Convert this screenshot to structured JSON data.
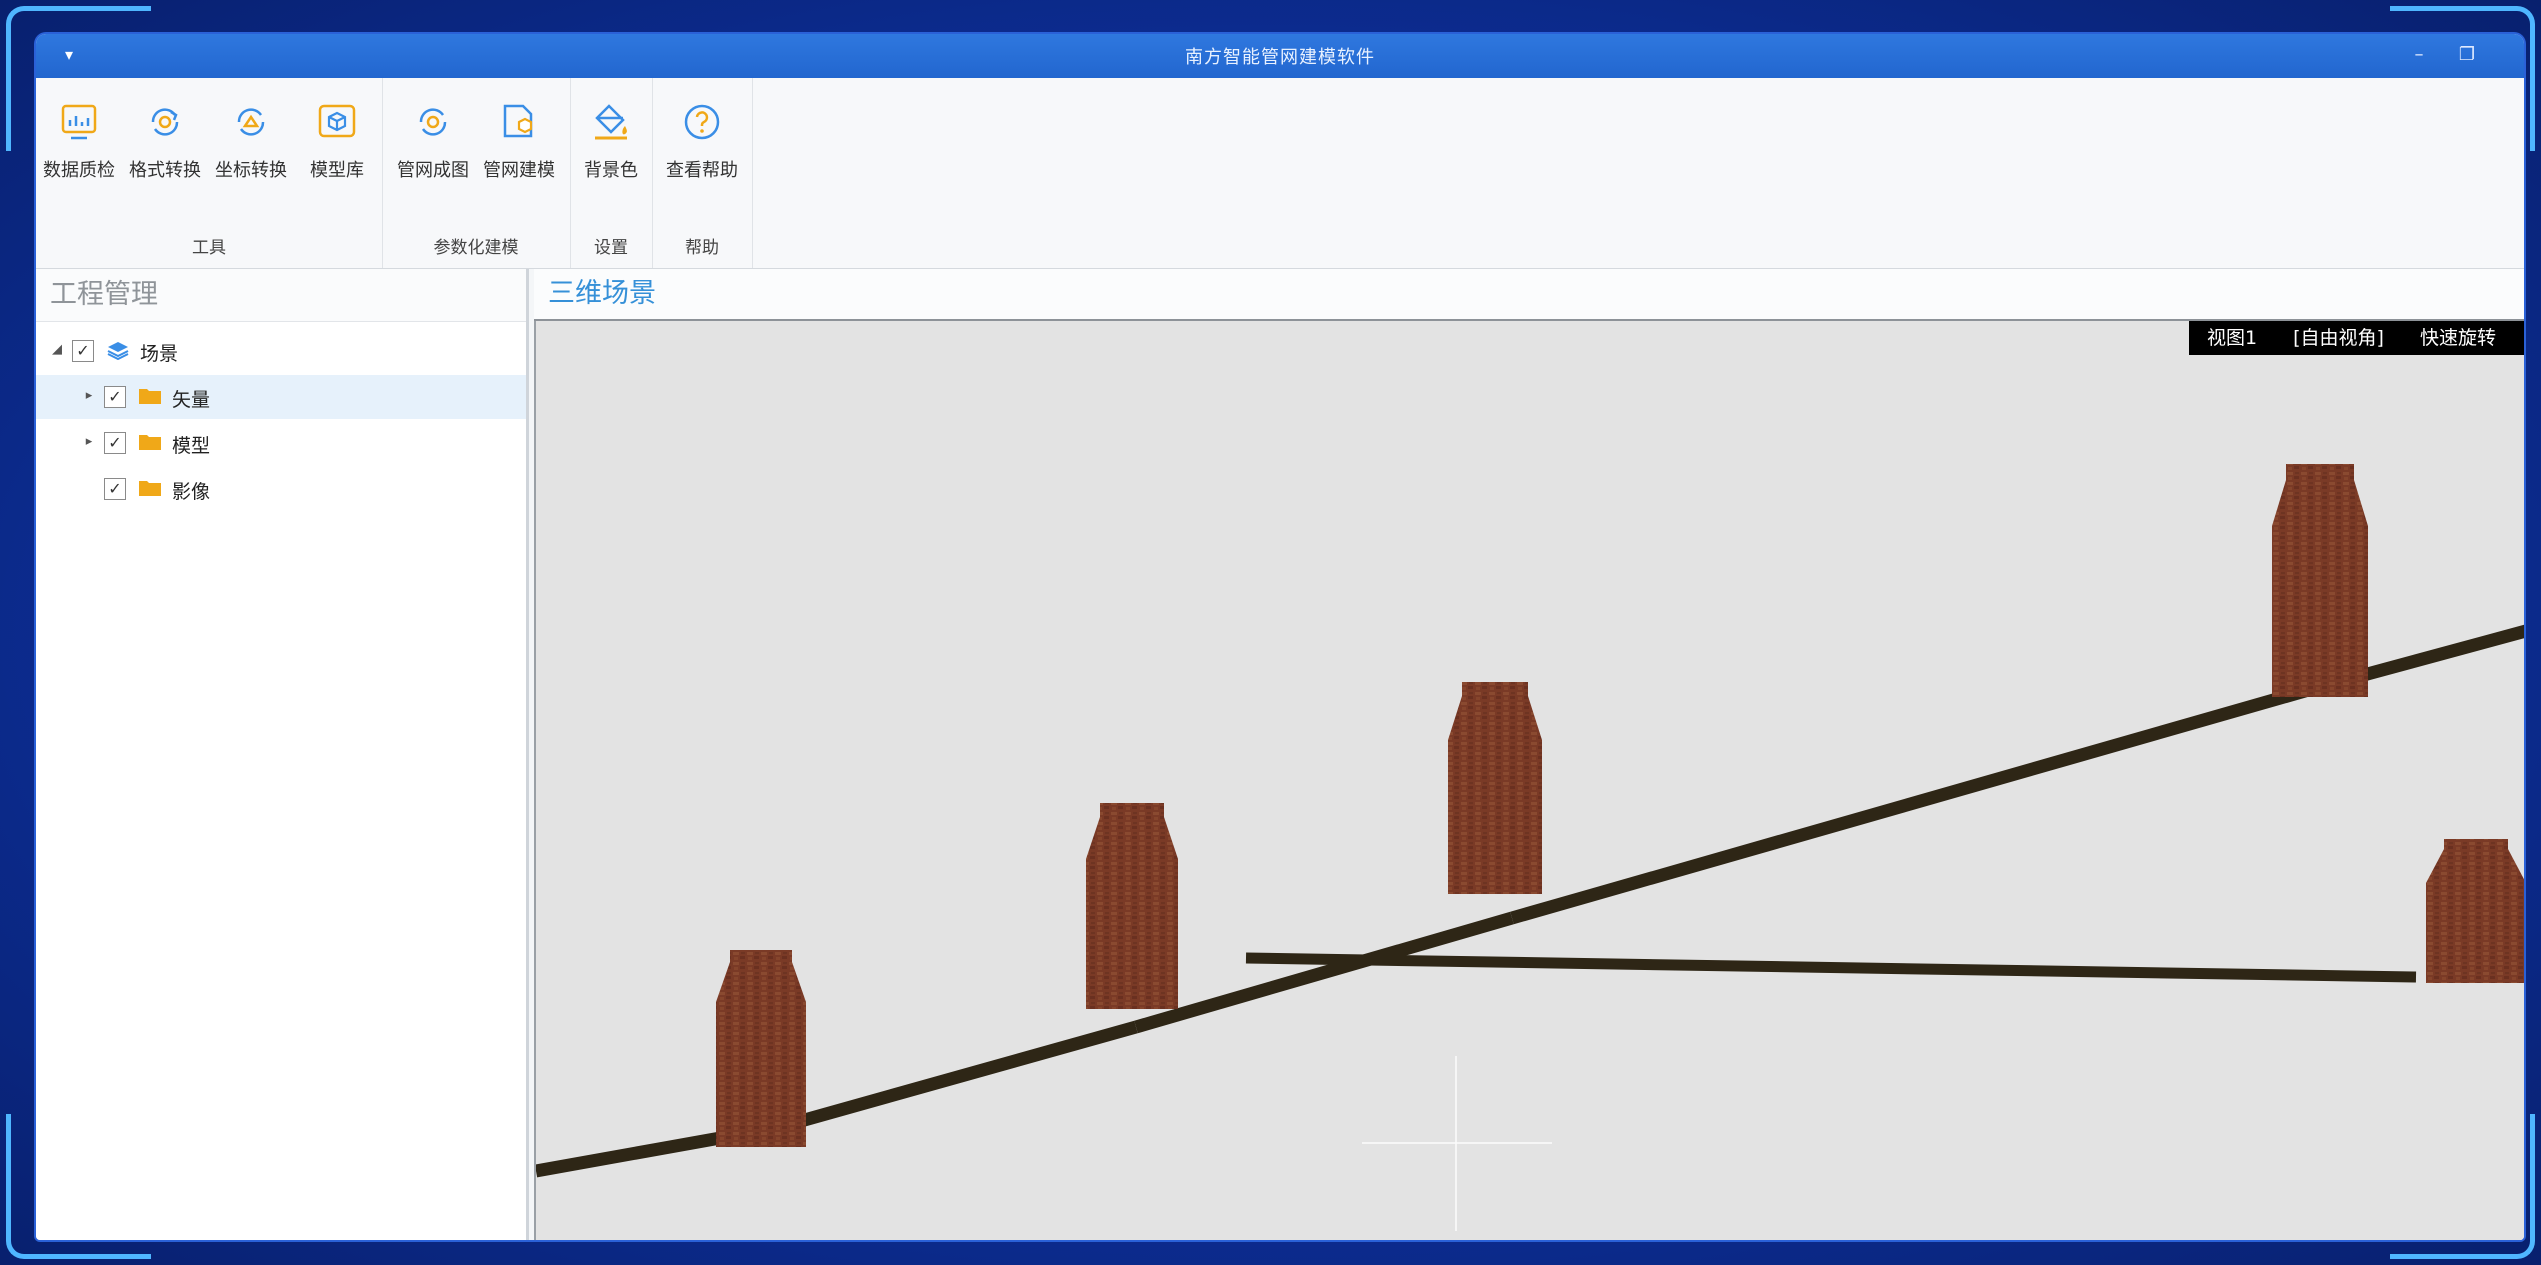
{
  "window": {
    "title": "南方智能管网建模软件",
    "minimize_glyph": "–",
    "maximize_glyph": "❐",
    "menu_glyph": "▾"
  },
  "ribbon": {
    "groups": [
      {
        "label": "工具",
        "buttons": [
          {
            "label": "数据质检",
            "icon": "data-check-icon"
          },
          {
            "label": "格式转换",
            "icon": "format-convert-icon"
          },
          {
            "label": "坐标转换",
            "icon": "coordinate-convert-icon"
          },
          {
            "label": "模型库",
            "icon": "model-library-icon"
          }
        ]
      },
      {
        "label": "参数化建模",
        "buttons": [
          {
            "label": "管网成图",
            "icon": "pipe-mapping-icon"
          },
          {
            "label": "管网建模",
            "icon": "pipe-modeling-icon"
          }
        ]
      },
      {
        "label": "设置",
        "buttons": [
          {
            "label": "背景色",
            "icon": "background-color-icon"
          }
        ]
      },
      {
        "label": "帮助",
        "buttons": [
          {
            "label": "查看帮助",
            "icon": "help-icon"
          }
        ]
      }
    ]
  },
  "project_panel": {
    "title": "工程管理",
    "tree": [
      {
        "label": "场景",
        "checked": true,
        "expanded": true,
        "level": 0,
        "icon": "layers-icon"
      },
      {
        "label": "矢量",
        "checked": true,
        "expanded": false,
        "level": 1,
        "icon": "folder-icon",
        "selected": true
      },
      {
        "label": "模型",
        "checked": true,
        "expanded": false,
        "level": 1,
        "icon": "folder-icon"
      },
      {
        "label": "影像",
        "checked": true,
        "expanded": false,
        "level": 1,
        "icon": "folder-icon"
      }
    ]
  },
  "scene_panel": {
    "title": "三维场景",
    "overlay": {
      "view": "视图1",
      "mode": "[自由视角]",
      "quick": "快速旋转"
    }
  },
  "colors": {
    "accent": "#2266cf",
    "scene_bg": "#e3e3e3",
    "pipe": "#2e2616",
    "manhole": "#7a3a26",
    "folder": "#f0a818"
  }
}
